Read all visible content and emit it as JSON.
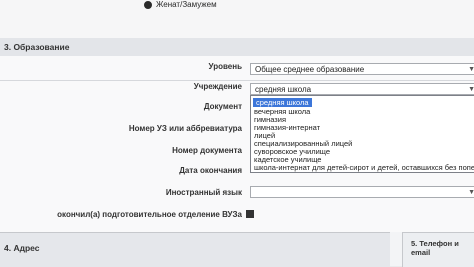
{
  "marital": {
    "option_label": "Женат/Замужем"
  },
  "section3": {
    "title": "3. Образование"
  },
  "education": {
    "level_label": "Уровень",
    "level_value": "Общее среднее образование",
    "institution_label": "Учреждение",
    "institution_value": "средняя школа",
    "document_label": "Документ",
    "uz_number_label": "Номер УЗ или аббревиатура",
    "doc_number_label": "Номер документа",
    "end_date_label": "Дата окончания",
    "foreign_lang_label": "Иностранный язык",
    "prep_dept_label": "окончил(а) подготовительное отделение ВУЗа"
  },
  "institution_options": [
    "средняя школа",
    "вечерняя школа",
    "гимназия",
    "гимназия-интернат",
    "лицей",
    "специализированный лицей",
    "суворовское училище",
    "кадетское училище",
    "школа-интернат для детей-сирот и детей, оставшихся без попечен"
  ],
  "section4": {
    "title": "4. Адрес"
  },
  "section5": {
    "title": "5. Телефон и email"
  }
}
